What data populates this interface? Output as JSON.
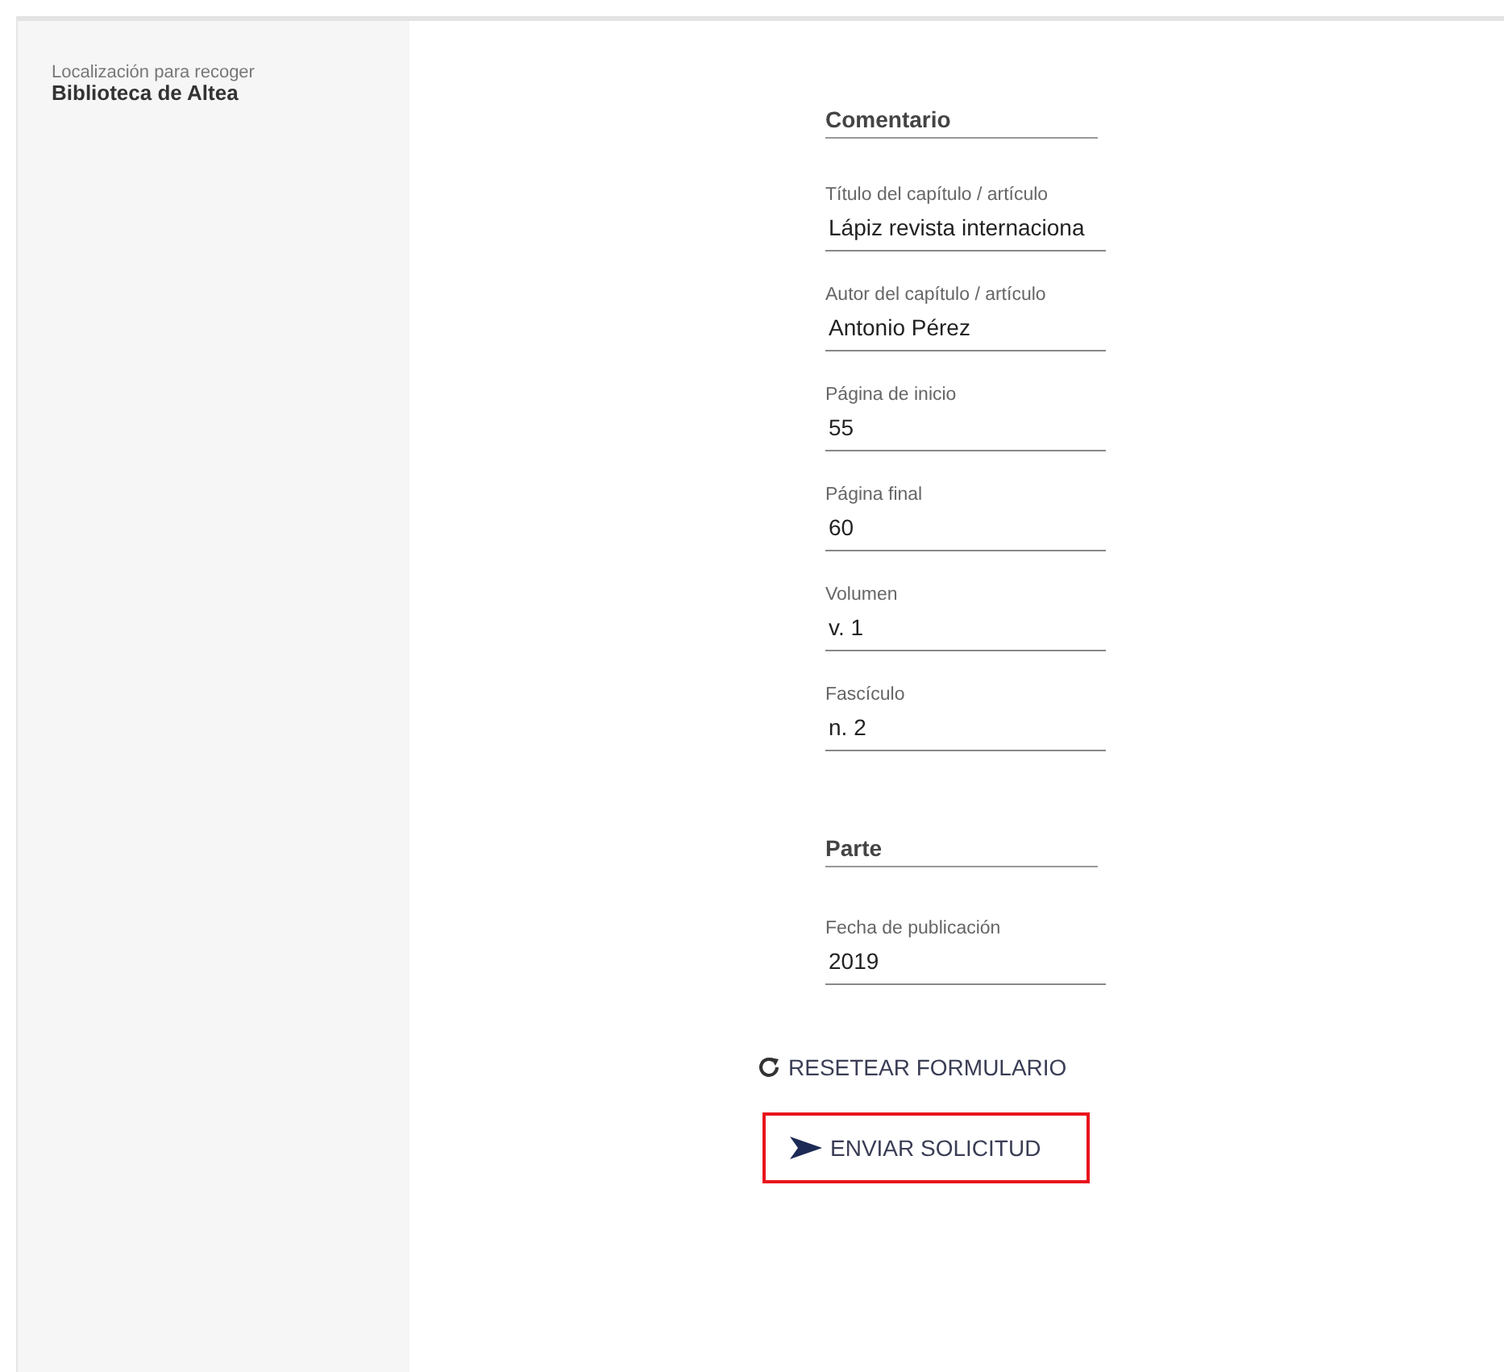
{
  "pickup": {
    "label": "Localización para recoger",
    "value": "Biblioteca de Altea"
  },
  "form": [
    {
      "kind": "section",
      "title": "Comentario"
    },
    {
      "kind": "field",
      "label": "Título del capítulo / artículo",
      "value": "Lápiz revista internaciona"
    },
    {
      "kind": "field",
      "label": "Autor del capítulo / artículo",
      "value": "Antonio Pérez"
    },
    {
      "kind": "field",
      "label": "Página de inicio",
      "value": "55"
    },
    {
      "kind": "field",
      "label": "Página final",
      "value": "60"
    },
    {
      "kind": "field",
      "label": "Volumen",
      "value": "v. 1"
    },
    {
      "kind": "field",
      "label": "Fascículo",
      "value": "n. 2"
    },
    {
      "kind": "section",
      "title": "Parte"
    },
    {
      "kind": "field",
      "label": "Fecha de publicación",
      "value": "2019"
    }
  ],
  "actions": [
    {
      "kind": "reset",
      "label": "RESETEAR FORMULARIO",
      "highlighted": false
    },
    {
      "kind": "submit",
      "label": "ENVIAR SOLICITUD",
      "highlighted": true
    }
  ]
}
